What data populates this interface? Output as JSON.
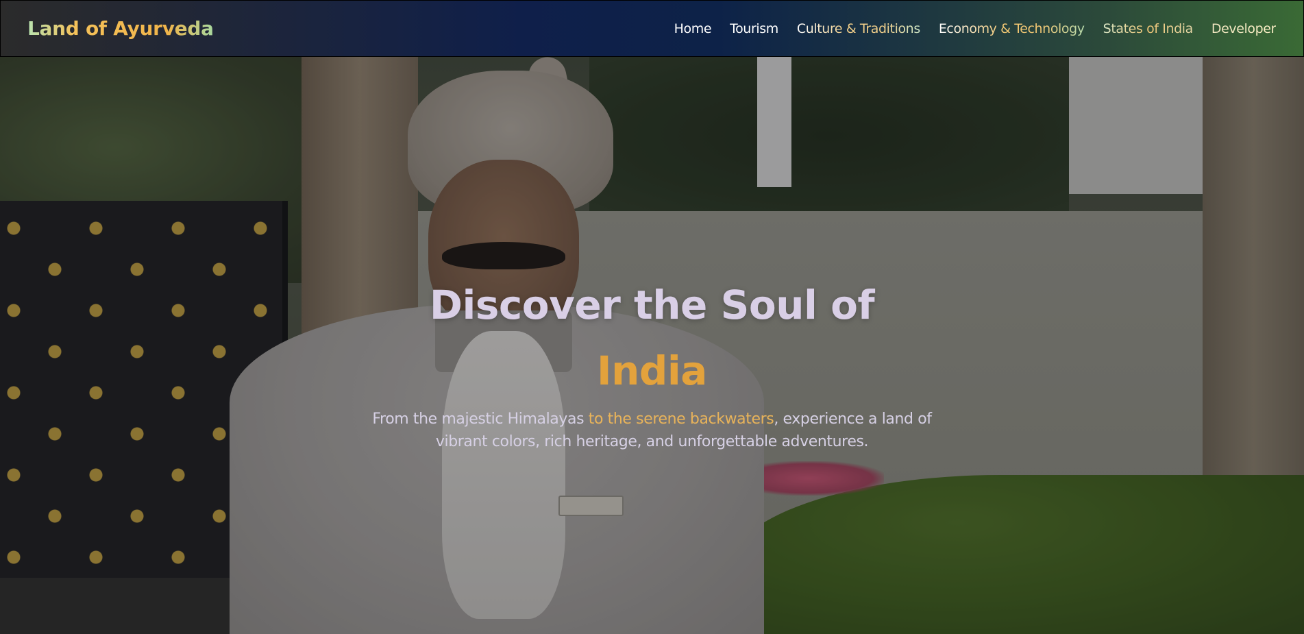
{
  "nav": {
    "brand": "Land of Ayurveda",
    "links": [
      {
        "label": "Home"
      },
      {
        "label": "Tourism"
      },
      {
        "label": "Culture & Traditions"
      },
      {
        "label": "Economy & Technology"
      },
      {
        "label": "States of India"
      },
      {
        "label": "Developer"
      }
    ]
  },
  "hero": {
    "title_line1": "Discover the Soul of",
    "title_line2": "India",
    "subtitle_part1": "From the majestic Himalayas ",
    "subtitle_highlight": "to the serene backwaters",
    "subtitle_part2": ", experience a land of vibrant colors, rich heritage, and unforgettable adventures."
  },
  "colors": {
    "accent": "#e3a23c",
    "title": "#d9cfe6"
  }
}
